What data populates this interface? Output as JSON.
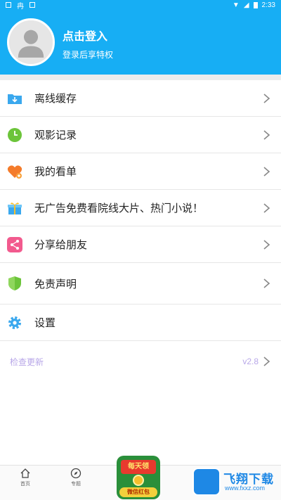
{
  "status_bar": {
    "time": "2:33",
    "battery_icon": "battery-icon",
    "wifi_icon": "wifi-icon"
  },
  "header": {
    "title": "点击登入",
    "subtitle": "登录后享特权",
    "avatar_icon": "user-avatar-icon"
  },
  "menu": {
    "items": [
      {
        "label": "离线缓存",
        "icon": "download-folder-icon",
        "color": "#3aa8ee"
      },
      {
        "label": "观影记录",
        "icon": "clock-icon",
        "color": "#6cc43a"
      },
      {
        "label": "我的看单",
        "icon": "heart-plus-icon",
        "color": "#f47b2a"
      },
      {
        "label": "无广告免费看院线大片、热门小说！",
        "icon": "gift-box-icon",
        "color": "#3aa8ee"
      },
      {
        "label": "分享给朋友",
        "icon": "share-icon",
        "color": "#f25a8e"
      },
      {
        "label": "免责声明",
        "icon": "shield-icon",
        "color": "#6cc43a"
      },
      {
        "label": "设置",
        "icon": "gear-icon",
        "color": "#3aa8ee"
      }
    ]
  },
  "update": {
    "label": "检查更新",
    "version": "v2.8"
  },
  "tabbar": {
    "home_label": "首页",
    "topic_label": "专题"
  },
  "promo": {
    "top_text": "每天领",
    "bottom_text": "微信红包"
  },
  "watermark": {
    "text": "飞翔下载",
    "url": "www.fxxz.com"
  },
  "colors": {
    "accent": "#17aef4",
    "update_text": "#b8a7e8"
  }
}
